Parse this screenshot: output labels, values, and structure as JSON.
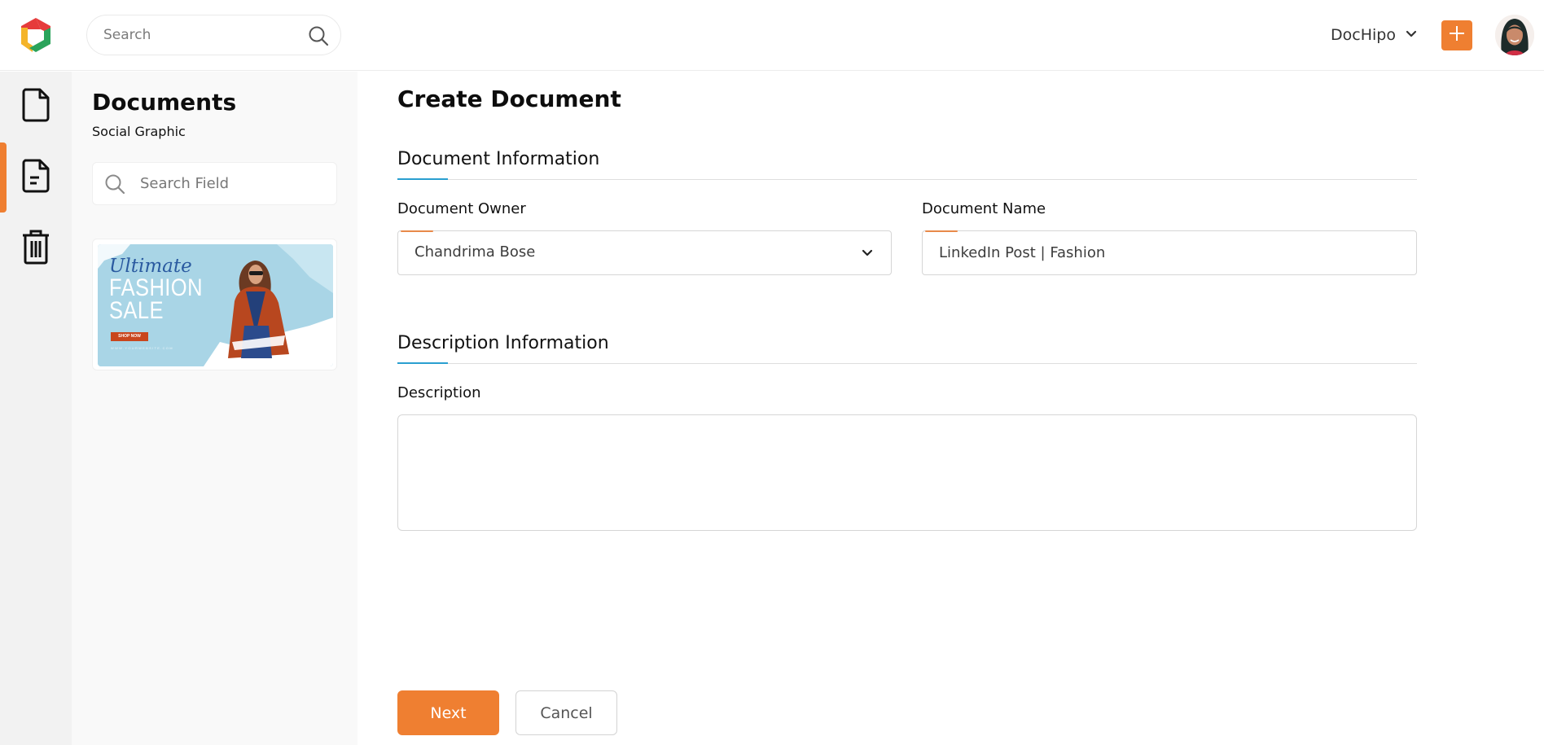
{
  "app": {
    "brand_colors": {
      "accent": "#ef7f31",
      "section_underline": "#2a9fd0",
      "logo_red": "#e63b3b",
      "logo_green": "#2aa35a",
      "logo_yellow": "#f4b42a"
    }
  },
  "header": {
    "search": {
      "placeholder": "Search",
      "value": "",
      "icon": "search-icon"
    },
    "account": {
      "name": "DocHipo",
      "icon": "chevron-down-icon"
    },
    "add_button": {
      "icon": "plus-icon"
    },
    "avatar": {
      "icon": "user-avatar"
    }
  },
  "rail": {
    "items": [
      {
        "name": "documents",
        "icon": "file-icon",
        "active": false
      },
      {
        "name": "document-details",
        "icon": "file-text-icon",
        "active": true
      },
      {
        "name": "trash",
        "icon": "trash-icon",
        "active": false
      }
    ]
  },
  "documents_panel": {
    "title": "Documents",
    "subtitle": "Social Graphic",
    "search": {
      "placeholder": "Search Field",
      "value": ""
    },
    "thumbnail": {
      "script_text": "Ultimate",
      "headline_line1": "FASHION",
      "headline_line2": "SALE",
      "cta": "SHOP NOW",
      "url": "WWW.YOURWEBSITE.COM"
    }
  },
  "form": {
    "title": "Create Document",
    "sections": [
      {
        "heading": "Document Information"
      },
      {
        "heading": "Description Information"
      }
    ],
    "fields": {
      "owner": {
        "label": "Document Owner",
        "value": "Chandrima Bose"
      },
      "name": {
        "label": "Document Name",
        "value": "LinkedIn Post | Fashion"
      },
      "description": {
        "label": "Description",
        "value": ""
      }
    },
    "buttons": {
      "next": "Next",
      "cancel": "Cancel"
    }
  }
}
